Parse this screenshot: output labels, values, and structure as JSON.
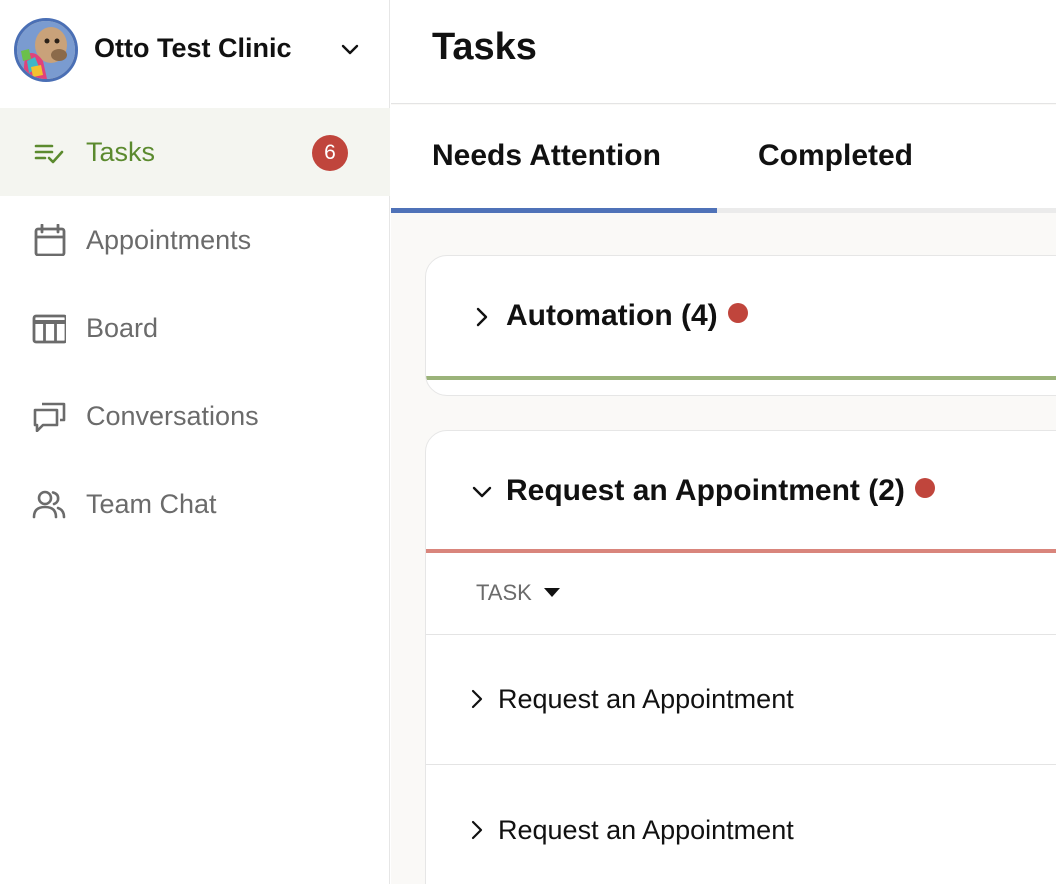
{
  "clinic": {
    "name": "Otto Test Clinic"
  },
  "sidebar": {
    "items": [
      {
        "label": "Tasks",
        "icon": "tasks-checklist-icon",
        "badge": "6",
        "active": true
      },
      {
        "label": "Appointments",
        "icon": "calendar-icon"
      },
      {
        "label": "Board",
        "icon": "board-columns-icon"
      },
      {
        "label": "Conversations",
        "icon": "chat-bubbles-icon"
      },
      {
        "label": "Team Chat",
        "icon": "team-users-icon"
      }
    ]
  },
  "header": {
    "title": "Tasks"
  },
  "tabs": [
    {
      "label": "Needs Attention",
      "active": true
    },
    {
      "label": "Completed",
      "active": false
    }
  ],
  "groups": [
    {
      "title": "Automation (4)",
      "expanded": false,
      "accent": "#9bb37a",
      "has_alert": true
    },
    {
      "title": "Request an Appointment (2)",
      "expanded": true,
      "accent": "#d9857c",
      "has_alert": true,
      "column_header": "TASK",
      "rows": [
        {
          "label": "Request an Appointment"
        },
        {
          "label": "Request an Appointment"
        }
      ]
    }
  ],
  "colors": {
    "active_tab_underline": "#4f72b8",
    "active_nav_text": "#5b8a2e",
    "badge": "#c0453c",
    "alert_dot": "#c0453c"
  }
}
